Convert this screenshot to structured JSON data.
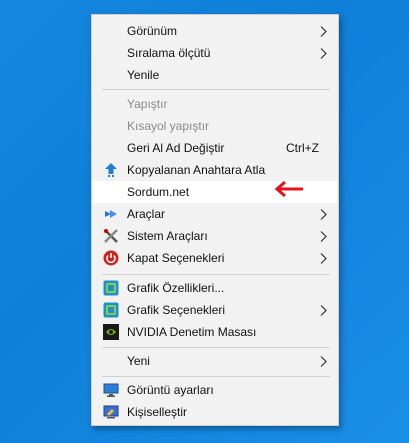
{
  "menu": {
    "items": [
      {
        "label": "Görünüm"
      },
      {
        "label": "Sıralama ölçütü"
      },
      {
        "label": "Yenile"
      },
      {
        "label": "Yapıştır"
      },
      {
        "label": "Kısayol yapıştır"
      },
      {
        "label": "Geri Al Ad Değiştir",
        "shortcut": "Ctrl+Z"
      },
      {
        "label": "Kopyalanan Anahtara Atla"
      },
      {
        "label": "Sordum.net"
      },
      {
        "label": "Araçlar"
      },
      {
        "label": "Sistem Araçları"
      },
      {
        "label": "Kapat Seçenekleri"
      },
      {
        "label": "Grafik Özellikleri..."
      },
      {
        "label": "Grafik Seçenekleri"
      },
      {
        "label": "NVIDIA Denetim Masası"
      },
      {
        "label": "Yeni"
      },
      {
        "label": "Görüntü ayarları"
      },
      {
        "label": "Kişiselleştir"
      }
    ]
  },
  "colors": {
    "desktop_bg": "#1587e0",
    "menu_bg": "#f2f2f2",
    "annotation_arrow": "#e8101a"
  },
  "icons": {
    "kopyalanan": "arrow-up-registry-icon",
    "araclar": "tools-arrow-icon",
    "sistem": "crossed-tools-icon",
    "kapat": "power-icon",
    "grafik_ozellikleri": "intel-graphics-icon",
    "grafik_secenekleri": "intel-graphics-icon",
    "nvidia": "nvidia-icon",
    "goruntu": "monitor-icon",
    "kisisellestir": "personalize-icon"
  }
}
